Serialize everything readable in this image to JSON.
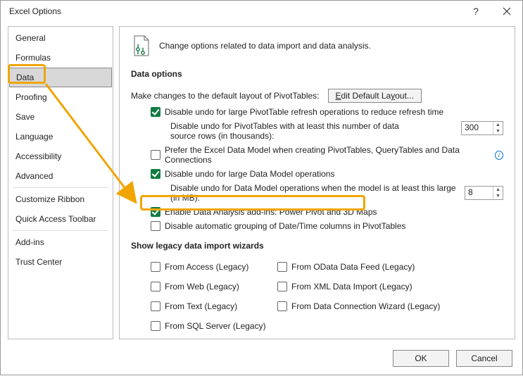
{
  "window": {
    "title": "Excel Options"
  },
  "sidebar": {
    "items": [
      "General",
      "Formulas",
      "Data",
      "Proofing",
      "Save",
      "Language",
      "Accessibility",
      "Advanced",
      "Customize Ribbon",
      "Quick Access Toolbar",
      "Add-ins",
      "Trust Center"
    ],
    "selected": "Data"
  },
  "intro": "Change options related to data import and data analysis.",
  "sections": {
    "data_options": {
      "title": "Data options",
      "pivot_label_pre": "Make changes to the default layout of PivotTables:",
      "edit_button": "Edit Default Layout...",
      "cb_disable_undo_pivot": "Disable undo for large PivotTable refresh operations to reduce refresh time",
      "lbl_disable_undo_pivot_rows": "Disable undo for PivotTables with at least this number of data source rows (in thousands):",
      "val_rows": "300",
      "cb_prefer_data_model": "Prefer the Excel Data Model when creating PivotTables, QueryTables and Data Connections",
      "cb_disable_undo_dm": "Disable undo for large Data Model operations",
      "lbl_disable_undo_dm_mb": "Disable undo for Data Model operations when the model is at least this large (in MB):",
      "val_mb": "8",
      "cb_enable_analysis": "Enable Data Analysis add-ins: Power Pivot and 3D Maps",
      "cb_disable_auto_group": "Disable automatic grouping of Date/Time columns in PivotTables"
    },
    "legacy": {
      "title": "Show legacy data import wizards",
      "items": [
        "From Access (Legacy)",
        "From OData Data Feed (Legacy)",
        "From Web (Legacy)",
        "From XML Data Import (Legacy)",
        "From Text (Legacy)",
        "From Data Connection Wizard (Legacy)",
        "From SQL Server (Legacy)"
      ]
    }
  },
  "footer": {
    "ok": "OK",
    "cancel": "Cancel"
  }
}
